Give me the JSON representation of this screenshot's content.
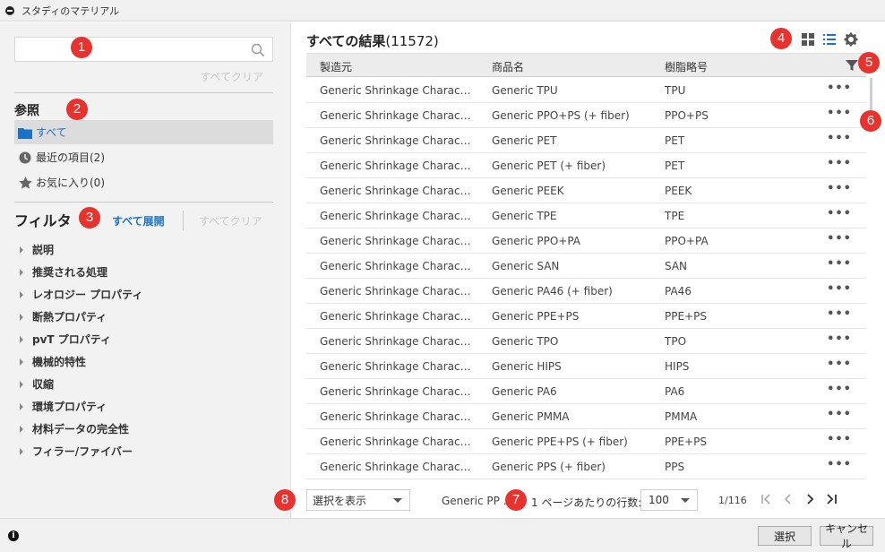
{
  "window": {
    "title": "スタディのマテリアル"
  },
  "sidebar": {
    "search": {
      "value": "",
      "placeholder": ""
    },
    "clear_search_label": "すべてクリア",
    "browse": {
      "title": "参照",
      "items": [
        {
          "label": "すべて",
          "icon": "folder-icon",
          "active": true
        },
        {
          "label": "最近の項目(2)",
          "icon": "clock-icon",
          "active": false
        },
        {
          "label": "お気に入り(0)",
          "icon": "star-icon",
          "active": false
        }
      ]
    },
    "filter": {
      "title": "フィルタ",
      "expand_all_label": "すべて展開",
      "clear_all_label": "すべてクリア",
      "items": [
        {
          "label": "説明"
        },
        {
          "label": "推奨される処理"
        },
        {
          "label": "レオロジー プロパティ"
        },
        {
          "label": "断熱プロパティ"
        },
        {
          "label": "pvT プロパティ"
        },
        {
          "label": "機械的特性"
        },
        {
          "label": "収縮"
        },
        {
          "label": "環境プロパティ"
        },
        {
          "label": "材料データの完全性"
        },
        {
          "label": "フィラー/ファイバー"
        }
      ]
    }
  },
  "main": {
    "results_title": "すべての結果",
    "results_count": "(11572)",
    "columns": [
      "製造元",
      "商品名",
      "樹脂略号"
    ],
    "rows": [
      {
        "maker": "Generic Shrinkage Charact…",
        "name": "Generic TPU",
        "abbr": "TPU"
      },
      {
        "maker": "Generic Shrinkage Charact…",
        "name": "Generic PPO+PS (+ fiber)",
        "abbr": "PPO+PS"
      },
      {
        "maker": "Generic Shrinkage Charact…",
        "name": "Generic PET",
        "abbr": "PET"
      },
      {
        "maker": "Generic Shrinkage Charact…",
        "name": "Generic PET (+ fiber)",
        "abbr": "PET"
      },
      {
        "maker": "Generic Shrinkage Charact…",
        "name": "Generic PEEK",
        "abbr": "PEEK"
      },
      {
        "maker": "Generic Shrinkage Charact…",
        "name": "Generic TPE",
        "abbr": "TPE"
      },
      {
        "maker": "Generic Shrinkage Charact…",
        "name": "Generic PPO+PA",
        "abbr": "PPO+PA"
      },
      {
        "maker": "Generic Shrinkage Charact…",
        "name": "Generic SAN",
        "abbr": "SAN"
      },
      {
        "maker": "Generic Shrinkage Charact…",
        "name": "Generic PA46 (+ fiber)",
        "abbr": "PA46"
      },
      {
        "maker": "Generic Shrinkage Charact…",
        "name": "Generic PPE+PS",
        "abbr": "PPE+PS"
      },
      {
        "maker": "Generic Shrinkage Charact…",
        "name": "Generic TPO",
        "abbr": "TPO"
      },
      {
        "maker": "Generic Shrinkage Charact…",
        "name": "Generic HIPS",
        "abbr": "HIPS"
      },
      {
        "maker": "Generic Shrinkage Charact…",
        "name": "Generic PA6",
        "abbr": "PA6"
      },
      {
        "maker": "Generic Shrinkage Charact…",
        "name": "Generic PMMA",
        "abbr": "PMMA"
      },
      {
        "maker": "Generic Shrinkage Charact…",
        "name": "Generic PPE+PS (+ fiber)",
        "abbr": "PPE+PS"
      },
      {
        "maker": "Generic Shrinkage Charact…",
        "name": "Generic PPS (+ fiber)",
        "abbr": "PPS"
      }
    ],
    "more_label": "•••"
  },
  "footer": {
    "show_selection": "選択を表示",
    "selected_name": "Generic PP …",
    "rows_per_page_label": "1 ページあたりの行数:",
    "rows_per_page": "100",
    "page_info": "1/116"
  },
  "statusbar": {
    "info_glyph": "i",
    "select_button": "選択",
    "cancel_button": "キャンセル"
  },
  "annotations": [
    "1",
    "2",
    "3",
    "4",
    "5",
    "6",
    "7",
    "8"
  ],
  "colors": {
    "accent": "#1a73c8",
    "badge": "#e8322e"
  }
}
